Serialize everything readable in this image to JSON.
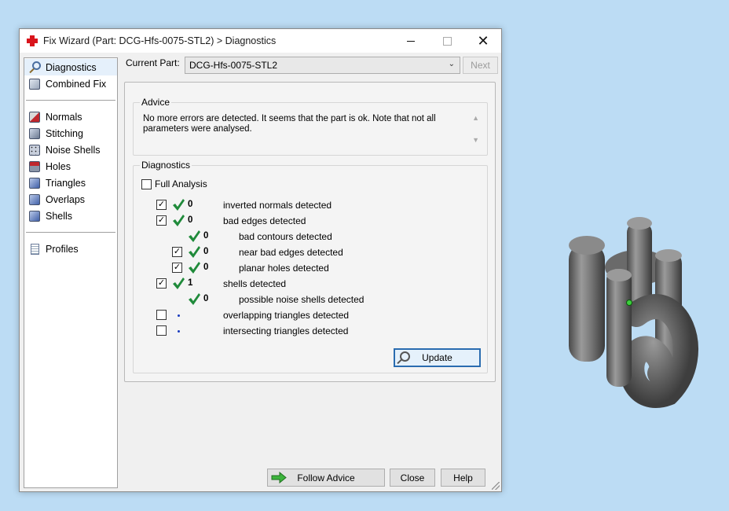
{
  "window": {
    "title": "Fix Wizard (Part: DCG-Hfs-0075-STL2) > Diagnostics"
  },
  "sidebar": {
    "items": [
      {
        "label": "Diagnostics",
        "icon": "magnifier-icon",
        "selected": true
      },
      {
        "label": "Combined Fix",
        "icon": "combined-fix-icon"
      },
      {
        "label": "Normals",
        "icon": "normals-icon"
      },
      {
        "label": "Stitching",
        "icon": "stitching-icon"
      },
      {
        "label": "Noise Shells",
        "icon": "noise-shells-icon"
      },
      {
        "label": "Holes",
        "icon": "holes-icon"
      },
      {
        "label": "Triangles",
        "icon": "triangles-icon"
      },
      {
        "label": "Overlaps",
        "icon": "overlaps-icon"
      },
      {
        "label": "Shells",
        "icon": "shells-icon"
      },
      {
        "label": "Profiles",
        "icon": "profiles-icon"
      }
    ]
  },
  "current_part": {
    "label": "Current Part:",
    "value": "DCG-Hfs-0075-STL2",
    "next_label": "Next"
  },
  "advice": {
    "title": "Advice",
    "text": "No more errors are detected. It seems that the part is ok. Note that not all parameters were analysed."
  },
  "diagnostics": {
    "title": "Diagnostics",
    "full_analysis_label": "Full Analysis",
    "rows": [
      {
        "checkbox": true,
        "checked": true,
        "status": "ok",
        "count": "0",
        "label": "inverted normals detected"
      },
      {
        "checkbox": true,
        "checked": true,
        "status": "ok",
        "count": "0",
        "label": "bad edges detected"
      },
      {
        "checkbox": false,
        "checked": false,
        "status": "ok",
        "count": "0",
        "label": "bad contours detected"
      },
      {
        "checkbox": true,
        "checked": true,
        "status": "ok",
        "count": "0",
        "label": "near bad edges detected"
      },
      {
        "checkbox": true,
        "checked": true,
        "status": "ok",
        "count": "0",
        "label": "planar holes detected"
      },
      {
        "checkbox": true,
        "checked": true,
        "status": "ok",
        "count": "1",
        "label": "shells detected"
      },
      {
        "checkbox": false,
        "checked": false,
        "status": "ok",
        "count": "0",
        "label": "possible noise shells detected"
      },
      {
        "checkbox": true,
        "checked": false,
        "status": "none",
        "count": "",
        "label": "overlapping triangles detected"
      },
      {
        "checkbox": true,
        "checked": false,
        "status": "none",
        "count": "",
        "label": "intersecting triangles detected"
      }
    ],
    "update_label": "Update"
  },
  "footer": {
    "follow_advice_label": "Follow Advice",
    "close_label": "Close",
    "help_label": "Help"
  },
  "colors": {
    "check_green": "#1f8a3a",
    "accent_blue": "#2a6cb0",
    "desktop": "#bcdcf4"
  }
}
